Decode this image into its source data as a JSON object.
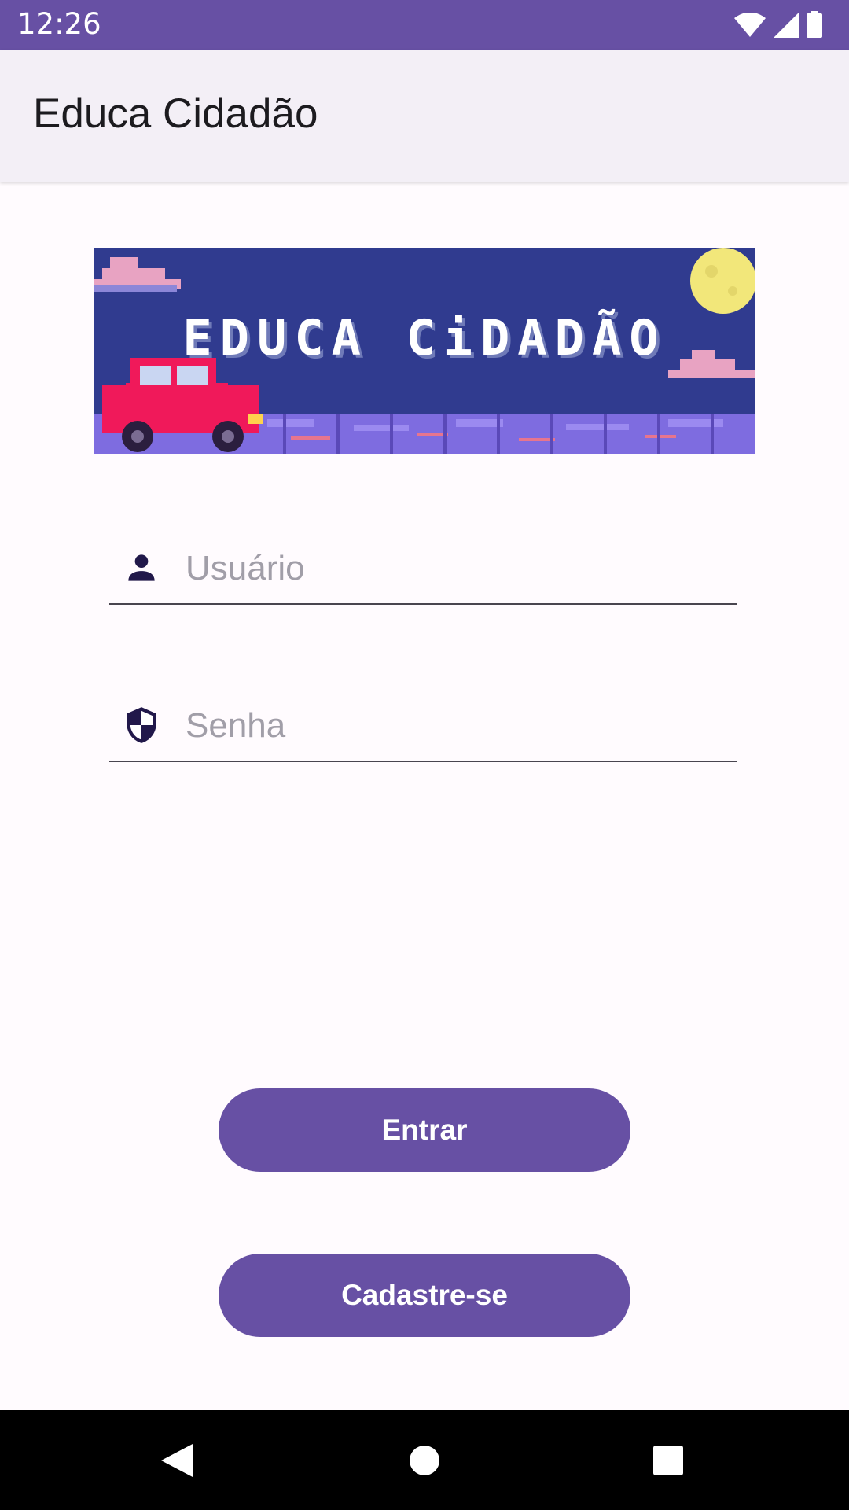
{
  "status_bar": {
    "time": "12:26",
    "icons": [
      "wifi-icon",
      "signal-icon",
      "battery-icon"
    ]
  },
  "app_bar": {
    "title": "Educa Cidadão"
  },
  "banner": {
    "logo_text": "EDUCA CiDADÃO"
  },
  "form": {
    "username": {
      "placeholder": "Usuário",
      "value": "",
      "icon": "person-icon"
    },
    "password": {
      "placeholder": "Senha",
      "value": "",
      "icon": "shield-icon"
    }
  },
  "buttons": {
    "enter_label": "Entrar",
    "signup_label": "Cadastre-se"
  },
  "nav": {
    "icons": [
      "back-icon",
      "home-icon",
      "recents-icon"
    ]
  },
  "colors": {
    "primary": "#6750A4",
    "app_bar_bg": "#F3EFF6",
    "background": "#FFFBFE",
    "banner_bg": "#303B8F"
  }
}
